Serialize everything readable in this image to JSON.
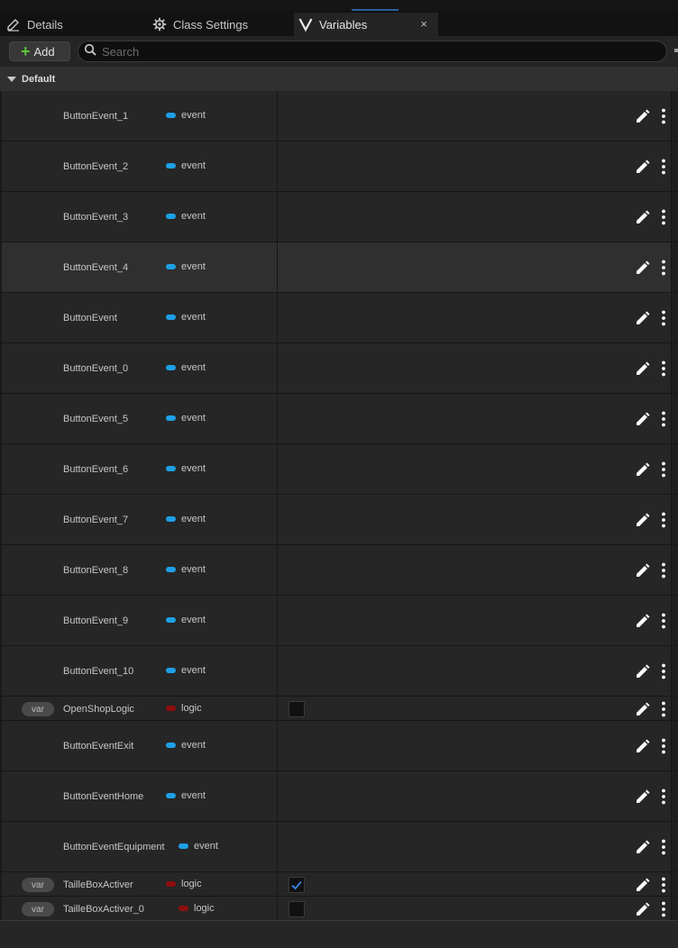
{
  "tabs": [
    {
      "label": "Details",
      "icon": "pencil-icon"
    },
    {
      "label": "Class Settings",
      "icon": "gear-icon"
    },
    {
      "label": "Variables",
      "icon": "variables-icon",
      "active": true,
      "close": "×"
    }
  ],
  "toolbar": {
    "add_label": "Add",
    "search_placeholder": "Search"
  },
  "section": {
    "label": "Default"
  },
  "colors": {
    "event_pin": "#1ea0e6",
    "logic_pin": "#8e0e0e",
    "add_plus": "#5cc43d",
    "check_accent": "#2f7fd8"
  },
  "variables": [
    {
      "name": "ButtonEvent_1",
      "type": "event"
    },
    {
      "name": "ButtonEvent_2",
      "type": "event"
    },
    {
      "name": "ButtonEvent_3",
      "type": "event"
    },
    {
      "name": "ButtonEvent_4",
      "type": "event",
      "highlighted": true
    },
    {
      "name": "ButtonEvent",
      "type": "event"
    },
    {
      "name": "ButtonEvent_0",
      "type": "event"
    },
    {
      "name": "ButtonEvent_5",
      "type": "event"
    },
    {
      "name": "ButtonEvent_6",
      "type": "event"
    },
    {
      "name": "ButtonEvent_7",
      "type": "event"
    },
    {
      "name": "ButtonEvent_8",
      "type": "event"
    },
    {
      "name": "ButtonEvent_9",
      "type": "event"
    },
    {
      "name": "ButtonEvent_10",
      "type": "event"
    },
    {
      "name": "OpenShopLogic",
      "type": "logic",
      "badge": "var",
      "checked": false
    },
    {
      "name": "ButtonEventExit",
      "type": "event"
    },
    {
      "name": "ButtonEventHome",
      "type": "event"
    },
    {
      "name": "ButtonEventEquipment",
      "type": "event"
    },
    {
      "name": "TailleBoxActiver",
      "type": "logic",
      "badge": "var",
      "checked": true
    },
    {
      "name": "TailleBoxActiver_0",
      "type": "logic",
      "badge": "var",
      "checked": false
    }
  ]
}
